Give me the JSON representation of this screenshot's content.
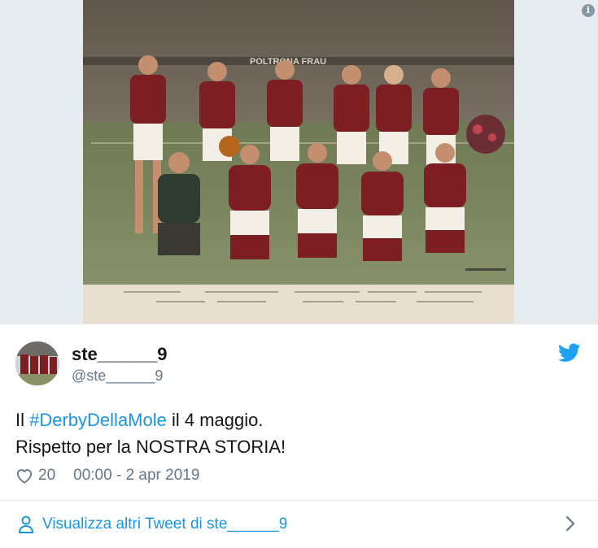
{
  "media": {
    "alt_icon": "info-icon",
    "image_kind": "colorized team photo",
    "banner_text": "POLTRONA FRAU"
  },
  "tweet": {
    "author_name": "ste______9",
    "author_handle": "@ste______9",
    "text_prefix": "Il ",
    "hashtag": "#DerbyDellaMole",
    "text_suffix": " il 4 maggio.",
    "line2": "Rispetto per la NOSTRA STORIA!",
    "likes": "20",
    "timestamp": "00:00 - 2 apr 2019"
  },
  "footer": {
    "link_label": "Visualizza altri Tweet di ste______9"
  },
  "colors": {
    "link": "#1b95e0",
    "muted": "#657786",
    "text": "#14171a",
    "divider": "#e6ecf0",
    "jersey": "#7d1f22"
  },
  "icons": [
    "info-icon",
    "twitter-bird-icon",
    "heart-icon",
    "person-icon",
    "chevron-right-icon"
  ]
}
